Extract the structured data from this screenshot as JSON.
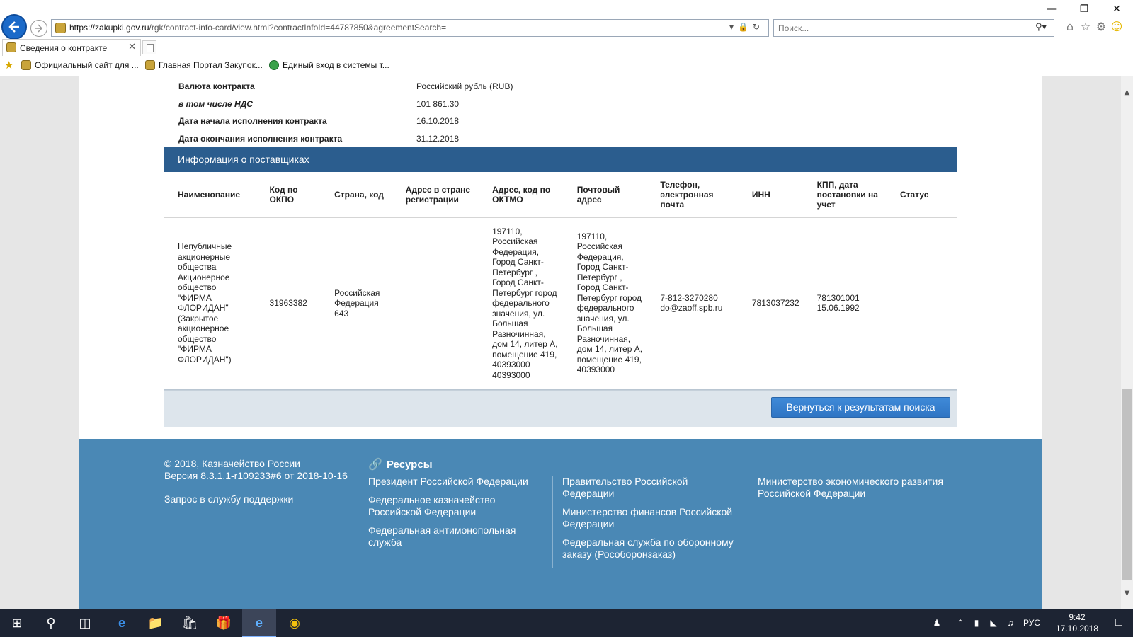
{
  "browser": {
    "url_host": "https://zakupki.gov.ru",
    "url_path": "/rgk/contract-info-card/view.html?contractInfoId=44787850&agreementSearch=",
    "search_placeholder": "Поиск...",
    "tab_title": "Сведения о контракте",
    "favorites": [
      {
        "label": "Официальный сайт для ..."
      },
      {
        "label": "Главная Портал Закупок..."
      },
      {
        "label": "Единый вход в системы т..."
      }
    ]
  },
  "contract": {
    "rows": [
      {
        "label": "Валюта контракта",
        "value": "Российский рубль (RUB)"
      },
      {
        "label": "в том числе НДС",
        "value": "101 861.30"
      },
      {
        "label": "Дата начала исполнения контракта",
        "value": "16.10.2018"
      },
      {
        "label": "Дата окончания исполнения контракта",
        "value": "31.12.2018"
      }
    ]
  },
  "suppliers": {
    "section_title": "Информация о поставщиках",
    "headers": [
      "Наименование",
      "Код по ОКПО",
      "Страна, код",
      "Адрес в стране регистрации",
      "Адрес, код по ОКТМО",
      "Почтовый адрес",
      "Телефон, электронная почта",
      "ИНН",
      "КПП, дата постановки на учет",
      "Статус"
    ],
    "rows": [
      {
        "name": "Непубличные акционерные общества Акционерное общество \"ФИРМА ФЛОРИДАН\" (Закрытое акционерное общество \"ФИРМА ФЛОРИДАН\")",
        "okpo": "31963382",
        "country": "Российская Федерация 643",
        "reg_address": "",
        "oktmo_address": "197110, Российская Федерация, Город Санкт-Петербург , Город Санкт-Петербург город федерального значения, ул. Большая Разночинная, дом 14, литер А, помещение 419, 40393000 40393000",
        "postal_address": "197110, Российская Федерация, Город Санкт-Петербург , Город Санкт-Петербург город федерального значения, ул. Большая Разночинная, дом 14, литер А, помещение 419, 40393000",
        "phone_email": "7-812-3270280 do@zaoff.spb.ru",
        "inn": "7813037232",
        "kpp_date": "781301001 15.06.1992",
        "status": ""
      }
    ]
  },
  "actions": {
    "back_to_results": "Вернуться к результатам поиска"
  },
  "footer": {
    "copyright": "© 2018, Казначейство России",
    "version": "Версия 8.3.1.1-r109233#6 от 2018-10-16",
    "support": "Запрос в службу поддержки",
    "resources_title": "Ресурсы",
    "col1": [
      "Президент Российской Федерации",
      "Федеральное казначейство Российской Федерации",
      "Федеральная антимонопольная служба"
    ],
    "col2": [
      "Правительство Российской Федерации",
      "Министерство финансов Российской Федерации",
      "Федеральная служба по оборонному заказу (Рособоронзаказ)"
    ],
    "col3": [
      "Министерство экономического развития Российской Федерации"
    ]
  },
  "taskbar": {
    "lang": "РУС",
    "time": "9:42",
    "date": "17.10.2018"
  }
}
